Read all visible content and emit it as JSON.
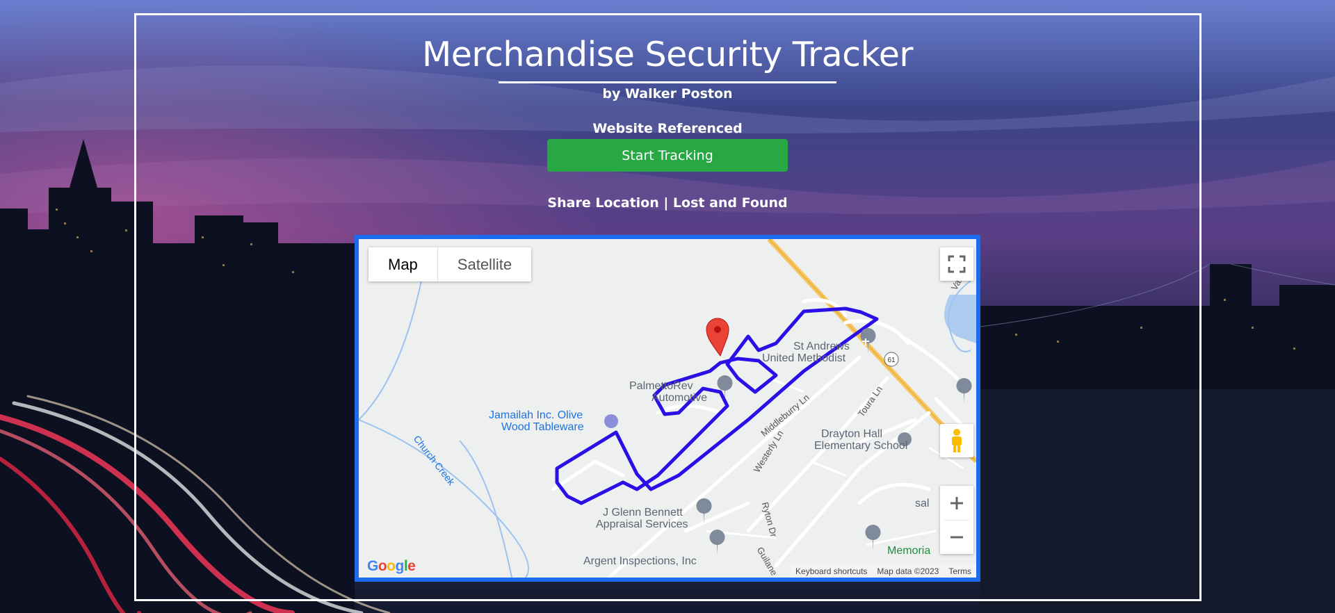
{
  "header": {
    "title": "Merchandise Security Tracker",
    "byline": "by Walker Poston",
    "reference": "Website Referenced",
    "start_button": "Start Tracking",
    "link_share": "Share Location",
    "link_separator": " | ",
    "link_lost": "Lost and Found"
  },
  "map": {
    "type_controls": {
      "map": "Map",
      "satellite": "Satellite",
      "selected": "Map"
    },
    "labels": {
      "st_andrews": "St Andrews",
      "united_methodist": "United Methodist",
      "palmetto_1": "PalmettoRev",
      "palmetto_2": "Automotive",
      "jamailah_1": "Jamailah Inc. Olive",
      "jamailah_2": "Wood Tableware",
      "church_creek": "Church Creek",
      "middleburry": "Middleburry Ln",
      "westerly": "Westerly Ln",
      "toura": "Toura Ln",
      "drayton_1": "Drayton Hall",
      "drayton_2": "Elementary School",
      "bennett_1": "J Glenn Bennett",
      "bennett_2": "Appraisal Services",
      "argent": "Argent Inspections, Inc",
      "ryton": "Ryton Dr",
      "sal": "sal",
      "memorial": "Memoria",
      "route": "61",
      "guiane": "Guilane",
      "vail": "Vail"
    },
    "footer": {
      "keyboard": "Keyboard shortcuts",
      "data": "Map data ©2023",
      "terms": "Terms"
    },
    "logo": "Google"
  },
  "colors": {
    "accent": "#28a745",
    "map_border": "#1a6cf0",
    "track": "#2a0fe6",
    "marker": "#ea4335"
  }
}
